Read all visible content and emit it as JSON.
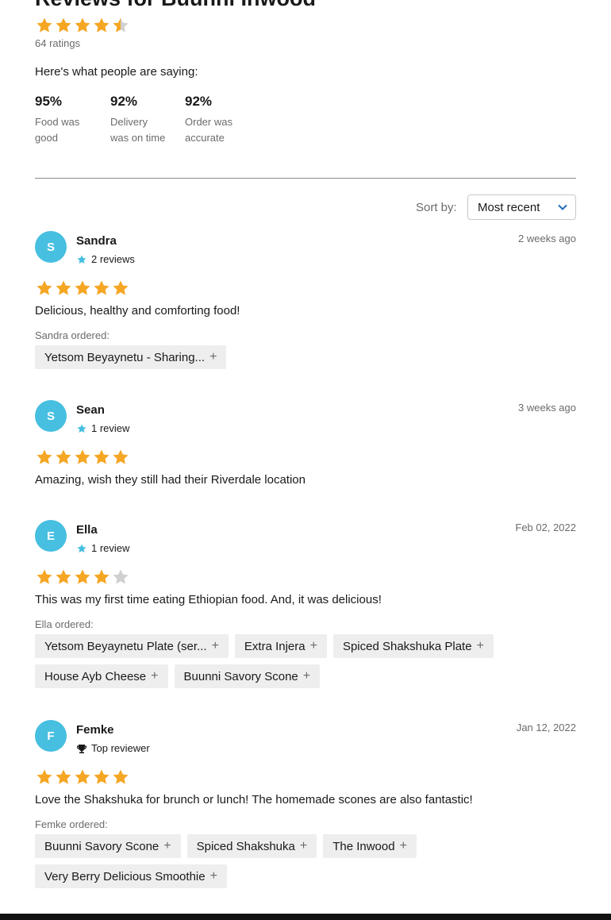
{
  "page": {
    "title": "Reviews for Buunni Inwood"
  },
  "summary": {
    "rating": 4.5,
    "ratings_count": "64 ratings",
    "saying_label": "Here's what people are saying:",
    "stats": [
      {
        "pct": "95%",
        "desc_line1": "Food was",
        "desc_line2": "good"
      },
      {
        "pct": "92%",
        "desc_line1": "Delivery",
        "desc_line2": "was on time"
      },
      {
        "pct": "92%",
        "desc_line1": "Order was",
        "desc_line2": "accurate"
      }
    ]
  },
  "sort": {
    "label": "Sort by:",
    "value": "Most recent"
  },
  "colors": {
    "star": "#f5a623",
    "star_empty": "#d0d0d0",
    "avatar": "#46bfe0",
    "meta_star": "#46bfe0"
  },
  "reviews": [
    {
      "initial": "S",
      "name": "Sandra",
      "meta_icon": "star-icon",
      "meta": "2 reviews",
      "date": "2 weeks ago",
      "rating": 5,
      "text": "Delicious, healthy and comforting food!",
      "ordered_label": "Sandra ordered:",
      "items": [
        "Yetsom Beyaynetu - Sharing..."
      ]
    },
    {
      "initial": "S",
      "name": "Sean",
      "meta_icon": "star-icon",
      "meta": "1 review",
      "date": "3 weeks ago",
      "rating": 5,
      "text": "Amazing, wish they still had their Riverdale location"
    },
    {
      "initial": "E",
      "name": "Ella",
      "meta_icon": "star-icon",
      "meta": "1 review",
      "date": "Feb 02, 2022",
      "rating": 4,
      "text": "This was my first time eating Ethiopian food. And, it was delicious!",
      "ordered_label": "Ella ordered:",
      "items": [
        "Yetsom Beyaynetu Plate (ser...",
        "Extra Injera",
        "Spiced Shakshuka Plate",
        "House Ayb Cheese",
        "Buunni Savory Scone"
      ]
    },
    {
      "initial": "F",
      "name": "Femke",
      "meta_icon": "trophy-icon",
      "meta": "Top reviewer",
      "date": "Jan 12, 2022",
      "rating": 5,
      "text": "Love the Shakshuka for brunch or lunch! The homemade scones are also fantastic!",
      "ordered_label": "Femke ordered:",
      "items": [
        "Buunni Savory Scone",
        "Spiced Shakshuka",
        "The Inwood",
        "Very Berry Delicious Smoothie"
      ]
    }
  ]
}
